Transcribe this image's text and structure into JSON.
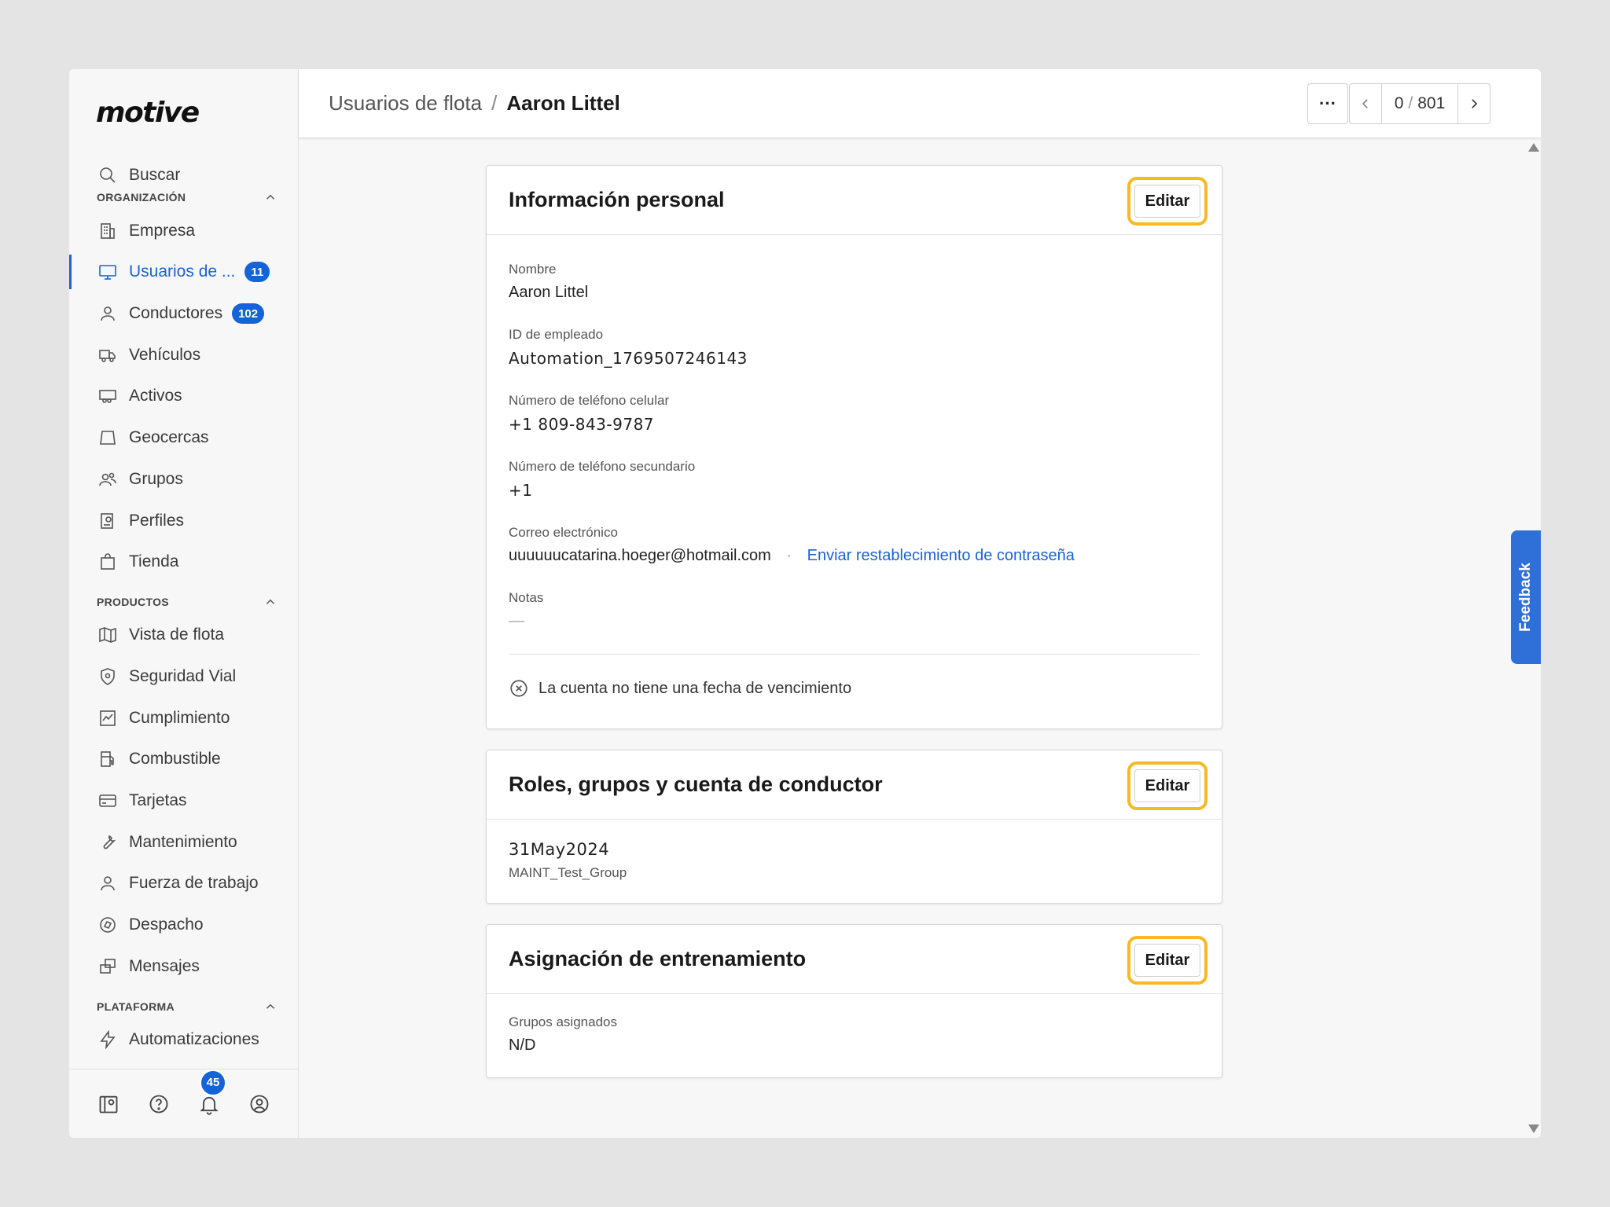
{
  "app": {
    "logo": "motive"
  },
  "sidebar": {
    "search_label": "Buscar",
    "sections": [
      {
        "title": "ORGANIZACIÓN"
      },
      {
        "title": "PRODUCTOS"
      },
      {
        "title": "PLATAFORMA"
      }
    ],
    "org_items": [
      {
        "label": "Empresa",
        "icon": "building-icon"
      },
      {
        "label": "Usuarios de ...",
        "icon": "monitor-icon",
        "badge": "11",
        "active": true
      },
      {
        "label": "Conductores",
        "icon": "user-icon",
        "badge": "102"
      },
      {
        "label": "Vehículos",
        "icon": "truck-icon"
      },
      {
        "label": "Activos",
        "icon": "trailer-icon"
      },
      {
        "label": "Geocercas",
        "icon": "geofence-icon"
      },
      {
        "label": "Grupos",
        "icon": "users-icon"
      },
      {
        "label": "Perfiles",
        "icon": "profile-settings-icon"
      },
      {
        "label": "Tienda",
        "icon": "shopping-bag-icon"
      }
    ],
    "product_items": [
      {
        "label": "Vista de flota",
        "icon": "map-icon"
      },
      {
        "label": "Seguridad Vial",
        "icon": "shield-icon"
      },
      {
        "label": "Cumplimiento",
        "icon": "chart-icon"
      },
      {
        "label": "Combustible",
        "icon": "fuel-icon"
      },
      {
        "label": "Tarjetas",
        "icon": "card-icon"
      },
      {
        "label": "Mantenimiento",
        "icon": "wrench-icon"
      },
      {
        "label": "Fuerza de trabajo",
        "icon": "person-icon"
      },
      {
        "label": "Despacho",
        "icon": "dispatch-icon"
      },
      {
        "label": "Mensajes",
        "icon": "messages-icon"
      }
    ],
    "platform_items": [
      {
        "label": "Automatizaciones",
        "icon": "lightning-icon"
      }
    ],
    "footer": {
      "notifications_count": "45"
    }
  },
  "header": {
    "breadcrumb_parent": "Usuarios de flota",
    "breadcrumb_separator": "/",
    "breadcrumb_current": "Aaron Littel",
    "more_label": "···",
    "pager_current": "0",
    "pager_separator": "/",
    "pager_total": "801"
  },
  "personal_info": {
    "title": "Información personal",
    "edit_label": "Editar",
    "name_label": "Nombre",
    "name_value": "Aaron Littel",
    "employee_id_label": "ID de empleado",
    "employee_id_value": "Automation_1769507246143",
    "mobile_label": "Número de teléfono celular",
    "mobile_value": "+1 809-843-9787",
    "secondary_label": "Número de teléfono secundario",
    "secondary_value": "+1",
    "email_label": "Correo electrónico",
    "email_value": "uuuuuucatarina.hoeger@hotmail.com",
    "email_separator": "·",
    "reset_link": "Enviar restablecimiento de contraseña",
    "notes_label": "Notas",
    "notes_value": "—",
    "expiry_text": "La cuenta no tiene una fecha de vencimiento"
  },
  "roles": {
    "title": "Roles, grupos y cuenta de conductor",
    "edit_label": "Editar",
    "role_value": "31May2024",
    "group_value": "MAINT_Test_Group"
  },
  "training": {
    "title": "Asignación de entrenamiento",
    "edit_label": "Editar",
    "groups_label": "Grupos asignados",
    "groups_value": "N/D"
  },
  "feedback_label": "Feedback",
  "colors": {
    "accent": "#1a63d6",
    "highlight": "#f7b924",
    "badge": "#1463d8"
  }
}
